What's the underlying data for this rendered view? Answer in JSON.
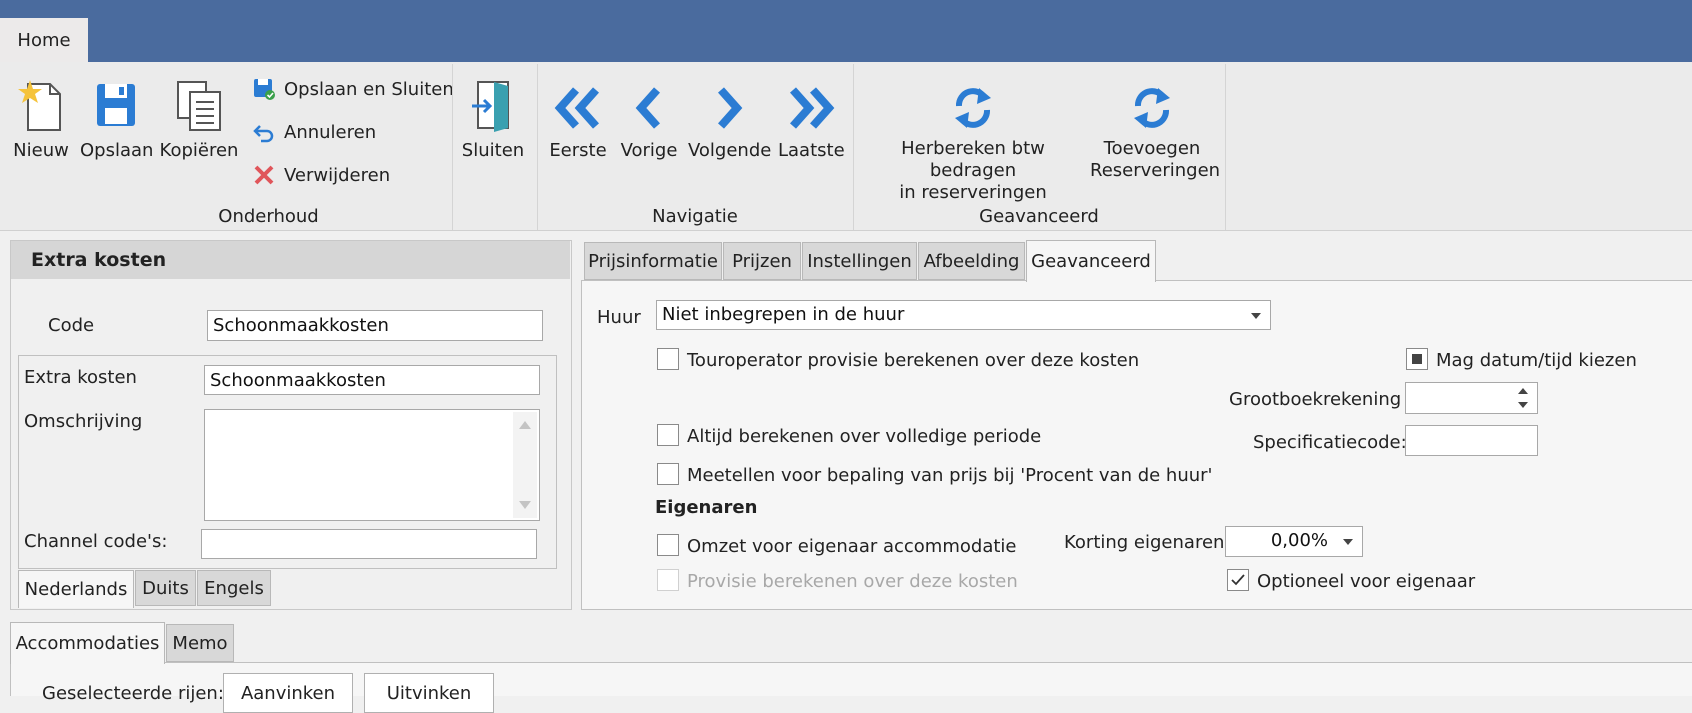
{
  "ribbon": {
    "home_tab": "Home",
    "buttons": {
      "nieuw": "Nieuw",
      "opslaan": "Opslaan",
      "kopieren": "Kopiëren",
      "opslaan_sluiten": "Opslaan en Sluiten",
      "annuleren": "Annuleren",
      "verwijderen": "Verwijderen",
      "sluiten": "Sluiten",
      "eerste": "Eerste",
      "vorige": "Vorige",
      "volgende": "Volgende",
      "laatste": "Laatste",
      "herbereken_line1": "Herbereken btw bedragen",
      "herbereken_line2": "in reserveringen",
      "toevoegen_line1": "Toevoegen",
      "toevoegen_line2": "Reserveringen"
    },
    "groups": {
      "onderhoud": "Onderhoud",
      "navigatie": "Navigatie",
      "geavanceerd": "Geavanceerd"
    },
    "colors": {
      "icon_blue": "#2b7cd3",
      "title_bar": "#4a6b9e",
      "delete_red": "#e0555a"
    }
  },
  "left_panel": {
    "title": "Extra kosten",
    "code_label": "Code",
    "code_value": "Schoonmaakkosten",
    "extra_kosten_label": "Extra kosten",
    "extra_kosten_value": "Schoonmaakkosten",
    "omschrijving_label": "Omschrijving",
    "channel_label": "Channel code's:",
    "lang_tabs": [
      "Nederlands",
      "Duits",
      "Engels"
    ]
  },
  "right_panel": {
    "tabs": [
      "Prijsinformatie",
      "Prijzen",
      "Instellingen",
      "Afbeelding",
      "Geavanceerd"
    ],
    "huur_label": "Huur",
    "huur_value": "Niet inbegrepen in de huur",
    "touroperator": "Touroperator provisie berekenen over deze kosten",
    "mag_datum": "Mag datum/tijd kiezen",
    "grootboek_label": "Grootboekrekening",
    "altijd": "Altijd berekenen over volledige periode",
    "specificatie_label": "Specificatiecode:",
    "meetellen": "Meetellen voor bepaling van prijs bij 'Procent van de huur'",
    "eigenaren_heading": "Eigenaren",
    "omzet": "Omzet voor eigenaar accommodatie",
    "korting_label": "Korting eigenaren",
    "korting_value": "0,00%",
    "provisie": "Provisie berekenen over deze kosten",
    "optioneel": "Optioneel voor eigenaar"
  },
  "bottom": {
    "tabs": [
      "Accommodaties",
      "Memo"
    ],
    "geselecteerde_label": "Geselecteerde rijen:",
    "aanvinken": "Aanvinken",
    "uitvinken": "Uitvinken"
  }
}
